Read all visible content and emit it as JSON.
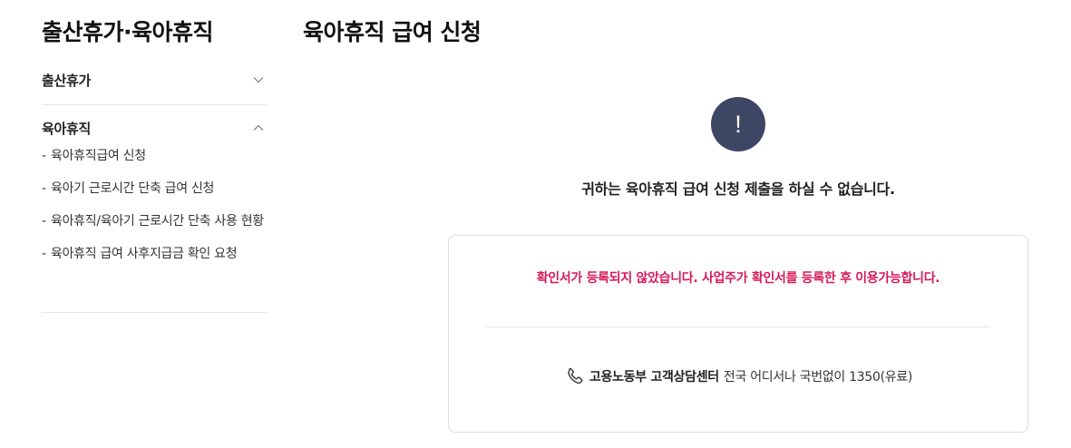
{
  "sidebar": {
    "title": "출산휴가·육아휴직",
    "groups": [
      {
        "label": "출산휴가",
        "expanded": false,
        "icon": "chevron-down-icon"
      },
      {
        "label": "육아휴직",
        "expanded": true,
        "icon": "chevron-up-icon",
        "items": [
          {
            "bullet": "-",
            "label": "육아휴직급여 신청"
          },
          {
            "bullet": "-",
            "label": "육아기 근로시간 단축 급여 신청"
          },
          {
            "bullet": "-",
            "label": "육아휴직/육아기 근로시간 단축 사용 현황"
          },
          {
            "bullet": "-",
            "label": "육아휴직 급여 사후지급금 확인 요청"
          }
        ]
      }
    ]
  },
  "main": {
    "title": "육아휴직 급여 신청",
    "alert_symbol": "!",
    "notice": "귀하는 육아휴직 급여 신청 제출을 하실 수 없습니다.",
    "warning": "확인서가 등록되지 않았습니다. 사업주가 확인서를 등록한 후 이용가능합니다.",
    "contact": {
      "icon": "phone-icon",
      "name": "고용노동부 고객상담센터",
      "detail": "전국 어디서나 국번없이 1350(유료)"
    }
  },
  "colors": {
    "alert_circle": "#3d4663",
    "warning_text": "#d6195a",
    "border": "#dcdcdc"
  }
}
